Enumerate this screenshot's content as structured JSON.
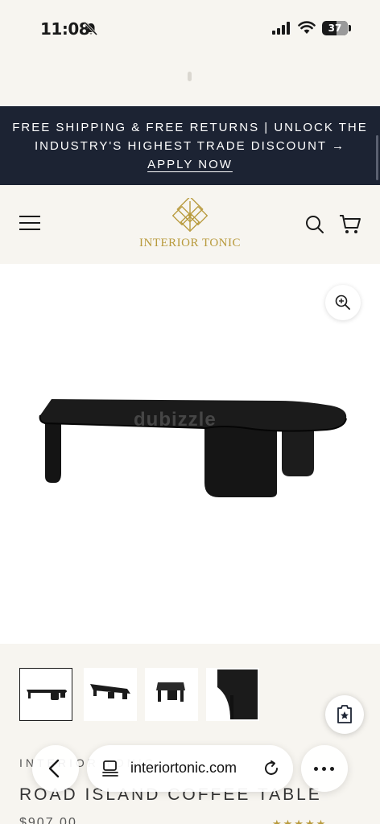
{
  "status": {
    "time": "11:08",
    "battery": "37"
  },
  "promo": {
    "line1": "FREE SHIPPING & FREE RETURNS | UNLOCK THE",
    "line2": "INDUSTRY'S HIGHEST TRADE DISCOUNT →",
    "link": "APPLY NOW"
  },
  "header": {
    "logo_text": "INTERIOR TONIC"
  },
  "product": {
    "watermark": "dubizzle",
    "brand": "INTERIOR TONIC",
    "title": "ROAD ISLAND COFFEE TABLE",
    "price": "$907.00",
    "rating": "★★★★★"
  },
  "browser": {
    "url": "interiortonic.com"
  },
  "colors": {
    "promo_bg": "#1c2333",
    "gold": "#b89a3c",
    "page_bg": "#f7f5f0"
  }
}
